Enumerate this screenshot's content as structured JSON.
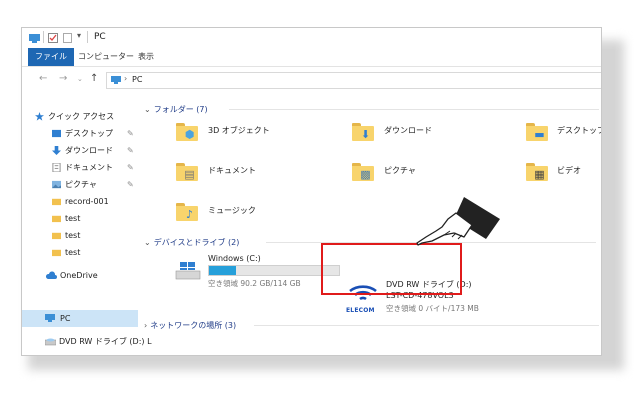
{
  "title": "PC",
  "ribbon_tabs": [
    "ファイル",
    "コンピューター",
    "表示"
  ],
  "address": {
    "path": "PC"
  },
  "sidebar": {
    "items": [
      {
        "label": "クイック アクセス",
        "icon": "star-icon",
        "pinned": false
      },
      {
        "label": "デスクトップ",
        "icon": "desktop-icon",
        "pinned": true
      },
      {
        "label": "ダウンロード",
        "icon": "download-icon",
        "pinned": true
      },
      {
        "label": "ドキュメント",
        "icon": "document-icon",
        "pinned": true
      },
      {
        "label": "ピクチャ",
        "icon": "picture-icon",
        "pinned": true
      },
      {
        "label": "record-001",
        "icon": "folder-icon",
        "pinned": false
      },
      {
        "label": "test",
        "icon": "folder-icon",
        "pinned": false
      },
      {
        "label": "test",
        "icon": "folder-icon",
        "pinned": false
      },
      {
        "label": "test",
        "icon": "folder-icon",
        "pinned": false
      },
      {
        "label": "OneDrive",
        "icon": "cloud-icon",
        "pinned": false
      },
      {
        "label": "PC",
        "icon": "pc-icon",
        "pinned": false
      },
      {
        "label": "DVD RW ドライブ (D:) L",
        "icon": "dvd-drive-icon",
        "pinned": false
      }
    ]
  },
  "sections": {
    "folders": "フォルダー (7)",
    "devices": "デバイスとドライブ (2)",
    "network": "ネットワークの場所 (3)"
  },
  "folders": [
    {
      "label": "3D オブジェクト",
      "icon": "3d-objects-icon"
    },
    {
      "label": "ダウンロード",
      "icon": "download-icon"
    },
    {
      "label": "デスクトップ",
      "icon": "desktop-icon"
    },
    {
      "label": "ドキュメント",
      "icon": "document-icon"
    },
    {
      "label": "ピクチャ",
      "icon": "picture-icon"
    },
    {
      "label": "ビデオ",
      "icon": "video-icon"
    },
    {
      "label": "ミュージック",
      "icon": "music-icon"
    }
  ],
  "drives": [
    {
      "name": "Windows (C:)",
      "free": "空き領域 90.2 GB/114 GB",
      "used_fraction": 0.21,
      "icon": "windows-drive-icon"
    },
    {
      "name": "DVD RW ドライブ (D:)",
      "label": "LST-CD-478VOL3",
      "free": "空き領域 0 バイト/173 MB",
      "brand": "ELECOM",
      "icon": "elecom-wifi-logo"
    }
  ],
  "colors": {
    "accent": "#1e67b3",
    "highlight_box": "#e01b1b",
    "selection": "#cce4f7",
    "folder": "#f8d46c"
  }
}
